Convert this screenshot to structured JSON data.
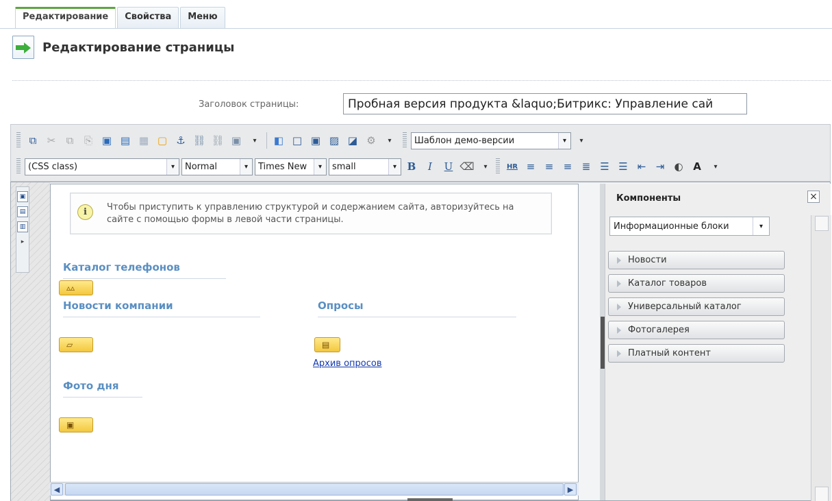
{
  "tabs": [
    {
      "label": "Редактирование"
    },
    {
      "label": "Свойства"
    },
    {
      "label": "Меню"
    }
  ],
  "page": {
    "title": "Редактирование страницы",
    "field_label": "Заголовок страницы:",
    "field_value": "Пробная версия продукта &laquo;Битрикс: Управление сай"
  },
  "toolbar": {
    "template_select": "Шаблон демо-версии",
    "css_class": "(CSS class)",
    "format": "Normal",
    "font": "Times New",
    "size": "small",
    "hr_label": "HR",
    "bold_label": "B",
    "italic_label": "I",
    "underline_label": "U",
    "font_style_label": "A"
  },
  "editor": {
    "notice": "Чтобы приступить к управлению структурой и содержанием сайта, авторизуйтесь на сайте с помощью формы в левой части страницы.",
    "sections": [
      {
        "heading": "Каталог телефонов"
      },
      {
        "heading": "Новости компании"
      },
      {
        "heading": "Опросы"
      },
      {
        "heading": "Фото дня"
      }
    ],
    "link": "Архив опросов"
  },
  "components": {
    "title": "Компоненты",
    "selected": "Информационные блоки",
    "items": [
      {
        "label": "Новости"
      },
      {
        "label": "Каталог товаров"
      },
      {
        "label": "Универсальный каталог"
      },
      {
        "label": "Фотогалерея"
      },
      {
        "label": "Платный контент"
      }
    ]
  },
  "icons": {
    "page": "page-edit-icon",
    "notice": "info-icon",
    "close": "close-icon",
    "dropdown": "chevron-down-icon"
  }
}
